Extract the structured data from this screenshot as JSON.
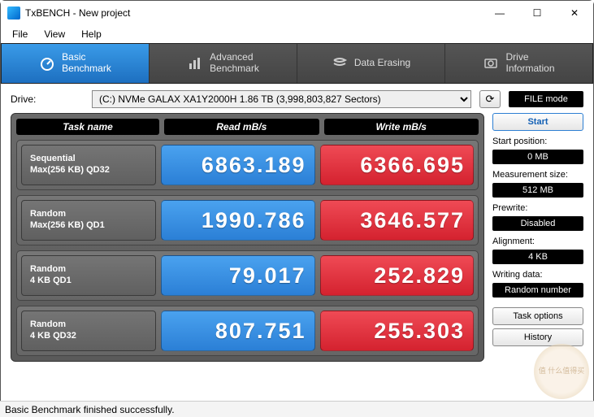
{
  "window": {
    "title": "TxBENCH - New project",
    "min": "—",
    "max": "☐",
    "close": "✕"
  },
  "menu": [
    "File",
    "View",
    "Help"
  ],
  "tabs": [
    {
      "label": "Basic\nBenchmark",
      "icon": "gauge"
    },
    {
      "label": "Advanced\nBenchmark",
      "icon": "bars"
    },
    {
      "label": "Data Erasing",
      "icon": "erase"
    },
    {
      "label": "Drive\nInformation",
      "icon": "disk"
    }
  ],
  "drive": {
    "label": "Drive:",
    "selected": "(C:) NVMe GALAX XA1Y2000H  1.86 TB (3,998,803,827 Sectors)",
    "file_mode": "FILE mode"
  },
  "headers": {
    "task": "Task name",
    "read": "Read mB/s",
    "write": "Write mB/s"
  },
  "results": [
    {
      "name1": "Sequential",
      "name2": "Max(256 KB) QD32",
      "read": "6863.189",
      "write": "6366.695"
    },
    {
      "name1": "Random",
      "name2": "Max(256 KB) QD1",
      "read": "1990.786",
      "write": "3646.577"
    },
    {
      "name1": "Random",
      "name2": "4 KB QD1",
      "read": "79.017",
      "write": "252.829"
    },
    {
      "name1": "Random",
      "name2": "4 KB QD32",
      "read": "807.751",
      "write": "255.303"
    }
  ],
  "side": {
    "start": "Start",
    "start_pos_label": "Start position:",
    "start_pos": "0 MB",
    "meas_label": "Measurement size:",
    "meas": "512 MB",
    "prewrite_label": "Prewrite:",
    "prewrite": "Disabled",
    "align_label": "Alignment:",
    "align": "4 KB",
    "wdata_label": "Writing data:",
    "wdata": "Random number",
    "task_options": "Task options",
    "history": "History"
  },
  "status": "Basic Benchmark finished successfully.",
  "watermark": "值 什么值得买"
}
